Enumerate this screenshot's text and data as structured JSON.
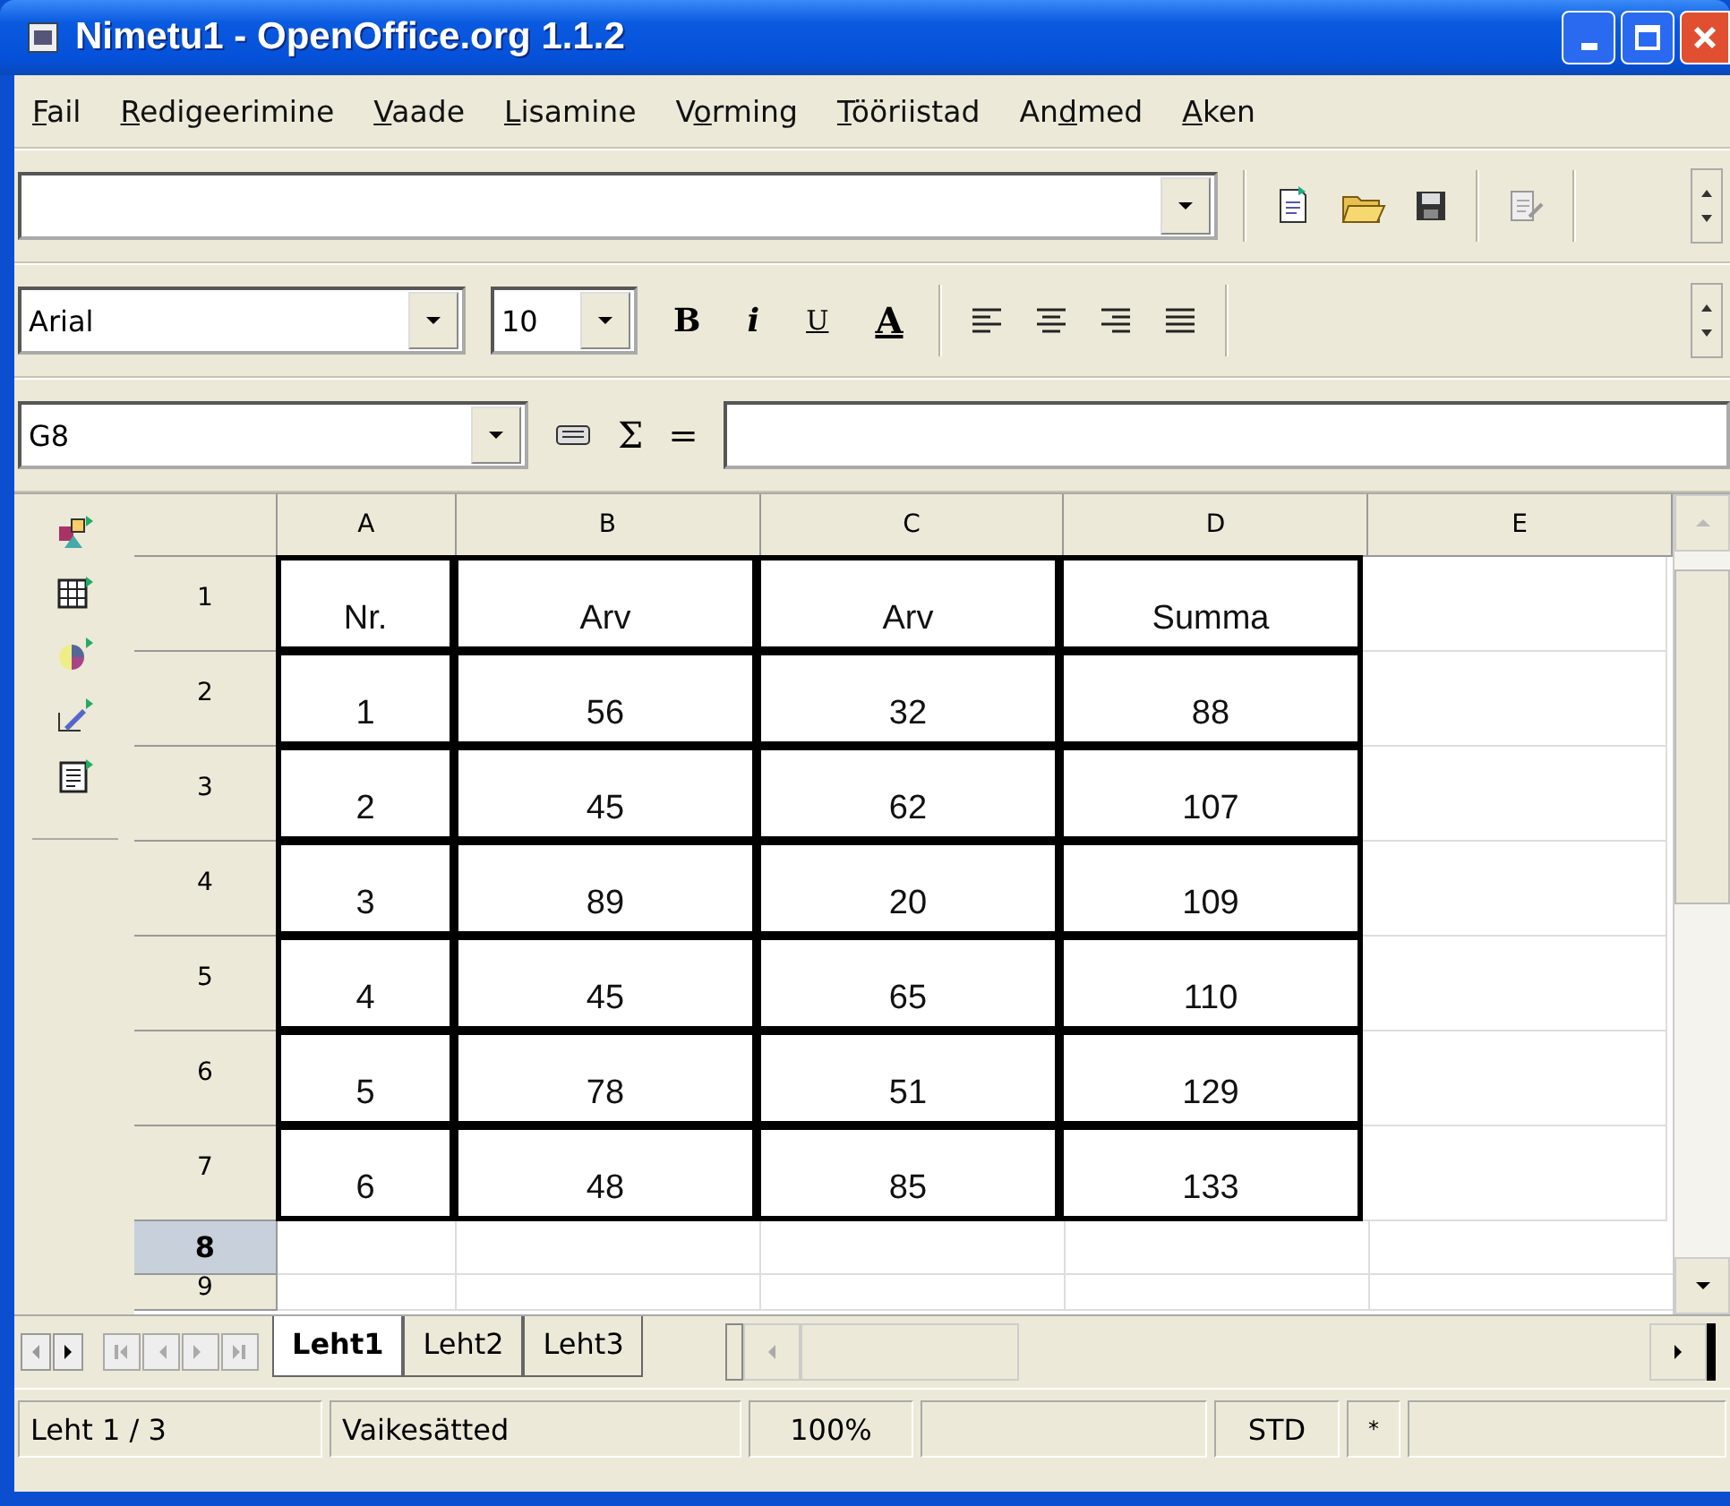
{
  "window": {
    "title": "Nimetu1 - OpenOffice.org 1.1.2"
  },
  "menu": [
    {
      "key": "F",
      "post": "ail"
    },
    {
      "key": "R",
      "post": "edigeerimine"
    },
    {
      "key": "V",
      "post": "aade"
    },
    {
      "key": "L",
      "post": "isamine"
    },
    {
      "pre": "V",
      "key": "o",
      "post": "rming"
    },
    {
      "key": "T",
      "post": "ööriistad"
    },
    {
      "pre": "An",
      "key": "d",
      "post": "med"
    },
    {
      "key": "A",
      "post": "ken"
    }
  ],
  "format_bar": {
    "font": "Arial",
    "size": "10",
    "buttons": [
      {
        "label": "B",
        "kind": "bold"
      },
      {
        "label": "i",
        "kind": "italic"
      },
      {
        "label": "U",
        "kind": "underline"
      },
      {
        "label": "A",
        "kind": "color"
      }
    ]
  },
  "formula_bar": {
    "name_box": "G8",
    "sum": "Σ",
    "equals": "="
  },
  "sheet": {
    "columns": [
      "A",
      "B",
      "C",
      "D",
      "E"
    ],
    "rows": [
      {
        "header": "1",
        "selected": false,
        "bordered": true,
        "cells": [
          "Nr.",
          "Arv",
          "Arv",
          "Summa"
        ]
      },
      {
        "header": "2",
        "selected": false,
        "bordered": true,
        "cells": [
          "1",
          "56",
          "32",
          "88"
        ]
      },
      {
        "header": "3",
        "selected": false,
        "bordered": true,
        "cells": [
          "2",
          "45",
          "62",
          "107"
        ]
      },
      {
        "header": "4",
        "selected": false,
        "bordered": true,
        "cells": [
          "3",
          "89",
          "20",
          "109"
        ]
      },
      {
        "header": "5",
        "selected": false,
        "bordered": true,
        "cells": [
          "4",
          "45",
          "65",
          "110"
        ]
      },
      {
        "header": "6",
        "selected": false,
        "bordered": true,
        "cells": [
          "5",
          "78",
          "51",
          "129"
        ]
      },
      {
        "header": "7",
        "selected": false,
        "bordered": true,
        "cells": [
          "6",
          "48",
          "85",
          "133"
        ]
      },
      {
        "header": "8",
        "selected": true,
        "bordered": false
      },
      {
        "header": "9",
        "selected": false,
        "bordered": false
      }
    ]
  },
  "sheet_tabs": [
    {
      "label": "Leht1",
      "selected": true
    },
    {
      "label": "Leht2",
      "selected": false
    },
    {
      "label": "Leht3",
      "selected": false
    }
  ],
  "status_bar": {
    "sheet": "Leht 1 / 3",
    "style": "Vaikesätted",
    "zoom": "100%",
    "mode": "STD",
    "modified": "*"
  }
}
